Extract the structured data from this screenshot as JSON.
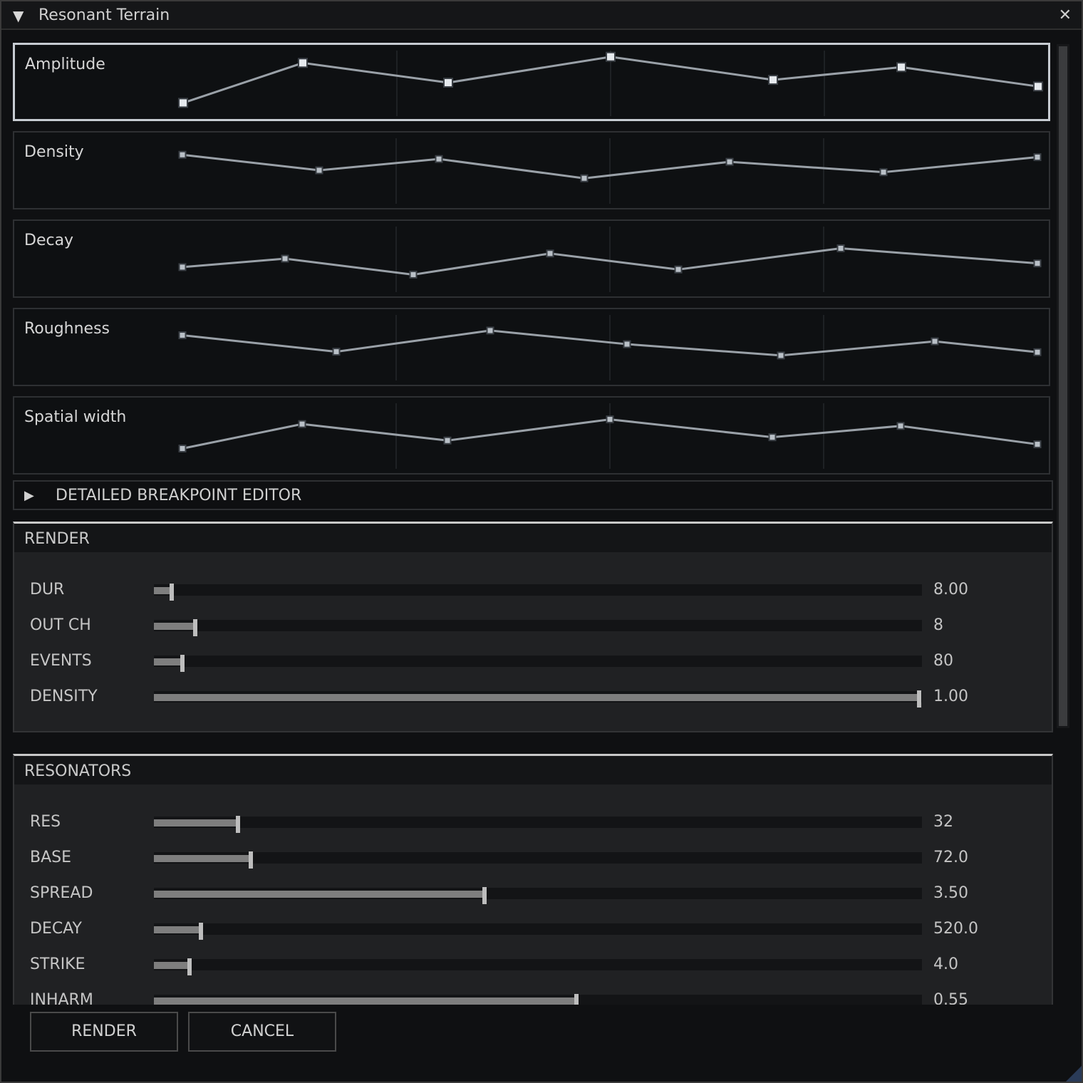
{
  "window": {
    "title": "Resonant Terrain",
    "collapse_glyph": "▼",
    "close_glyph": "✕"
  },
  "envelopes": [
    {
      "label": "Amplitude",
      "points": [
        [
          0.0,
          0.1
        ],
        [
          0.14,
          0.95
        ],
        [
          0.31,
          0.53
        ],
        [
          0.5,
          1.08
        ],
        [
          0.69,
          0.59
        ],
        [
          0.84,
          0.86
        ],
        [
          1.0,
          0.45
        ]
      ],
      "selected": true
    },
    {
      "label": "Density",
      "points": [
        [
          0.0,
          0.86
        ],
        [
          0.16,
          0.53
        ],
        [
          0.3,
          0.77
        ],
        [
          0.47,
          0.36
        ],
        [
          0.64,
          0.71
        ],
        [
          0.82,
          0.49
        ],
        [
          1.0,
          0.81
        ]
      ],
      "selected": false
    },
    {
      "label": "Decay",
      "points": [
        [
          0.0,
          0.35
        ],
        [
          0.12,
          0.53
        ],
        [
          0.27,
          0.19
        ],
        [
          0.43,
          0.64
        ],
        [
          0.58,
          0.3
        ],
        [
          0.77,
          0.75
        ],
        [
          1.0,
          0.43
        ]
      ],
      "selected": false
    },
    {
      "label": "Roughness",
      "points": [
        [
          0.0,
          0.78
        ],
        [
          0.18,
          0.43
        ],
        [
          0.36,
          0.88
        ],
        [
          0.52,
          0.59
        ],
        [
          0.7,
          0.35
        ],
        [
          0.88,
          0.65
        ],
        [
          1.0,
          0.42
        ]
      ],
      "selected": false
    },
    {
      "label": "Spatial width",
      "points": [
        [
          0.0,
          0.25
        ],
        [
          0.14,
          0.77
        ],
        [
          0.31,
          0.42
        ],
        [
          0.5,
          0.87
        ],
        [
          0.69,
          0.49
        ],
        [
          0.84,
          0.73
        ],
        [
          1.0,
          0.34
        ]
      ],
      "selected": false
    }
  ],
  "breakpoint_editor": {
    "arrow_glyph": "▶",
    "label": "DETAILED BREAKPOINT EDITOR"
  },
  "render_section": {
    "title": "RENDER",
    "rows": [
      {
        "label": "DUR",
        "value": "8.00",
        "level": 0.023
      },
      {
        "label": "OUT CH",
        "value": "8",
        "level": 0.054
      },
      {
        "label": "EVENTS",
        "value": "80",
        "level": 0.037
      },
      {
        "label": "DENSITY",
        "value": "1.00",
        "level": 0.996
      }
    ]
  },
  "resonators_section": {
    "title": "RESONATORS",
    "rows": [
      {
        "label": "RES",
        "value": "32",
        "level": 0.109
      },
      {
        "label": "BASE",
        "value": "72.0",
        "level": 0.126
      },
      {
        "label": "SPREAD",
        "value": "3.50",
        "level": 0.43
      },
      {
        "label": "DECAY",
        "value": "520.0",
        "level": 0.061
      },
      {
        "label": "STRIKE",
        "value": "4.0",
        "level": 0.046
      },
      {
        "label": "INHARM",
        "value": "0.55",
        "level": 0.55
      }
    ]
  },
  "buttons": {
    "render": "RENDER",
    "cancel": "CANCEL"
  },
  "colors": {
    "curve": "#9aa1a8",
    "point_fill": "#b9c0c7",
    "selected_point_fill": "#e6eaee",
    "grid": "#1e2124"
  }
}
